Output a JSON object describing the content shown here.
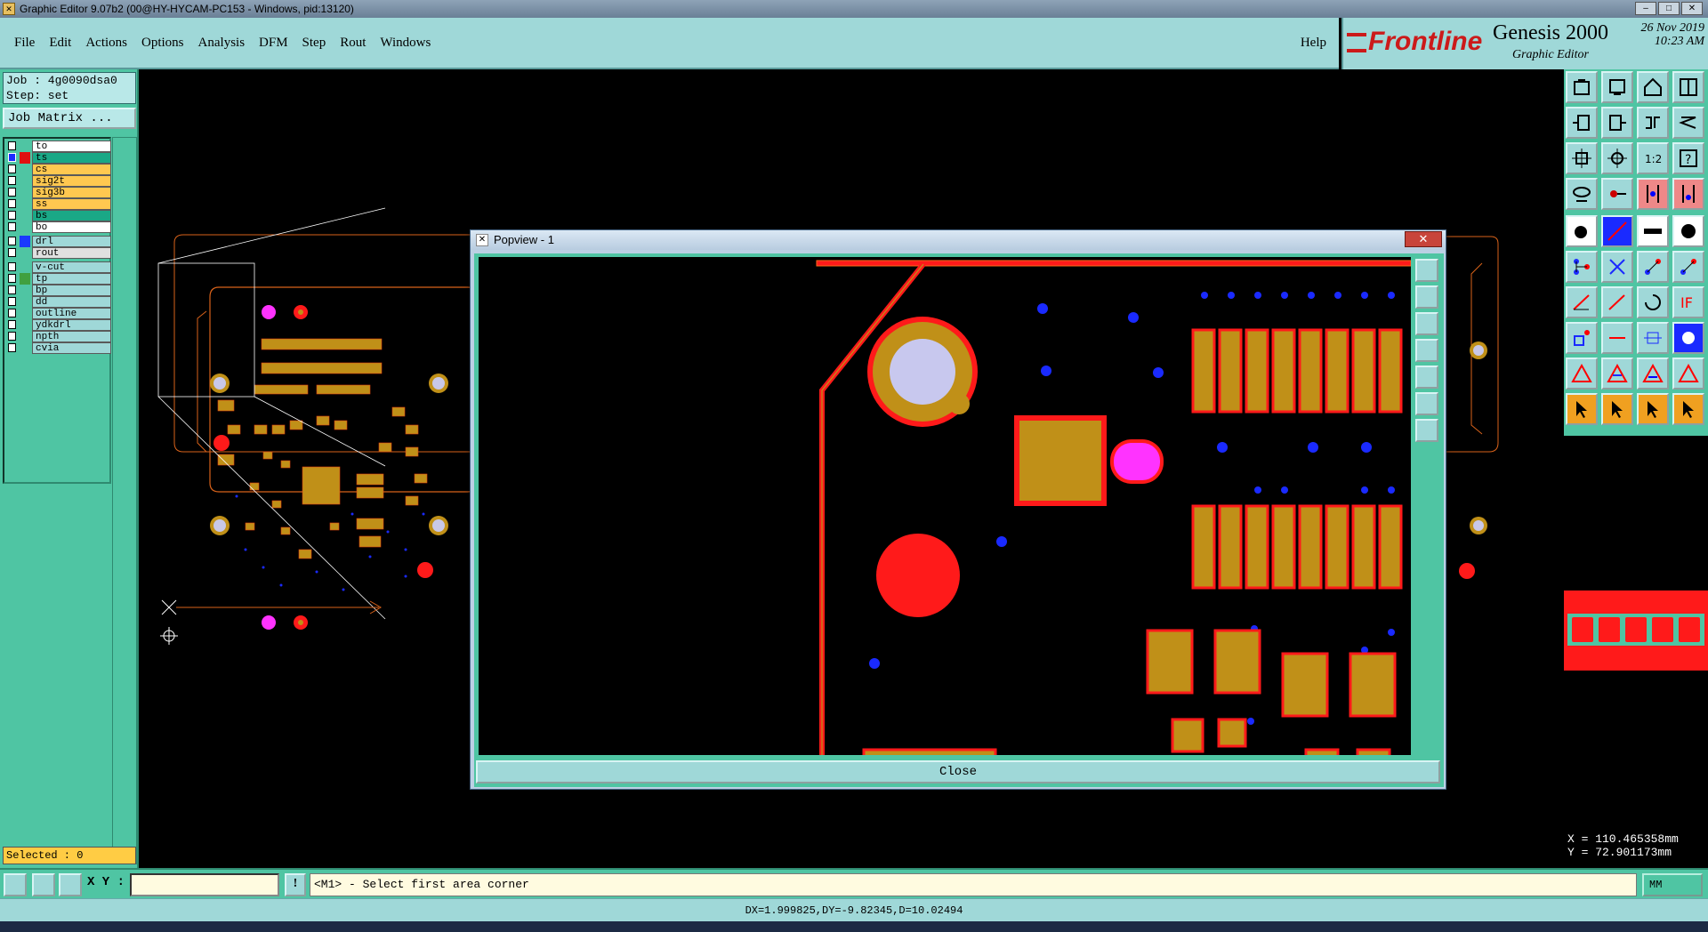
{
  "window": {
    "title": "Graphic Editor 9.07b2 (00@HY-HYCAM-PC153 - Windows, pid:13120)"
  },
  "menu": {
    "items": [
      "File",
      "Edit",
      "Actions",
      "Options",
      "Analysis",
      "DFM",
      "Step",
      "Rout",
      "Windows"
    ],
    "help": "Help"
  },
  "brand": {
    "logo": "Frontline",
    "product": "Genesis 2000",
    "subtitle": "Graphic Editor",
    "date": "26 Nov 2019",
    "time": "10:23 AM"
  },
  "job": {
    "job_label": "Job : 4g0090dsa0",
    "step_label": "Step: set",
    "matrix_button": "Job Matrix ..."
  },
  "layers": [
    {
      "name": "to",
      "color": "#ffffff",
      "swatch": ""
    },
    {
      "name": "ts",
      "color": "#1aa886",
      "swatch": "#e01010",
      "active": true
    },
    {
      "name": "cs",
      "color": "#ffc850",
      "swatch": ""
    },
    {
      "name": "sig2t",
      "color": "#ffc850",
      "swatch": ""
    },
    {
      "name": "sig3b",
      "color": "#ffc850",
      "swatch": ""
    },
    {
      "name": "ss",
      "color": "#ffc850",
      "swatch": ""
    },
    {
      "name": "bs",
      "color": "#1aa886",
      "swatch": ""
    },
    {
      "name": "bo",
      "color": "#ffffff",
      "swatch": ""
    },
    {
      "name": "drl",
      "color": "#9fd8d8",
      "swatch": "#1a3aff"
    },
    {
      "name": "rout",
      "color": "#e0e0e0",
      "swatch": ""
    },
    {
      "name": "v-cut",
      "color": "#9fd8d8",
      "swatch": ""
    },
    {
      "name": "tp",
      "color": "#9fd8d8",
      "swatch": "#40a040"
    },
    {
      "name": "bp",
      "color": "#9fd8d8",
      "swatch": ""
    },
    {
      "name": "dd",
      "color": "#9fd8d8",
      "swatch": ""
    },
    {
      "name": "outline",
      "color": "#9fd8d8",
      "swatch": ""
    },
    {
      "name": "ydkdrl",
      "color": "#9fd8d8",
      "swatch": ""
    },
    {
      "name": "npth",
      "color": "#9fd8d8",
      "swatch": ""
    },
    {
      "name": "cvia",
      "color": "#9fd8d8",
      "swatch": ""
    }
  ],
  "selected": "Selected : 0",
  "popup": {
    "title": "Popview - 1",
    "close_button": "Close"
  },
  "coords": {
    "x": "X = 110.465358mm",
    "y": "Y = 72.901173mm"
  },
  "cmd": {
    "xy_label": "X Y :",
    "xy_value": "",
    "info": "!",
    "prompt": "<M1> - Select first area corner",
    "units": "MM"
  },
  "status": "DX=1.999825,DY=-9.82345,D=10.02494",
  "colors": {
    "copper": "#c09018",
    "pad_outline": "#ff1a1a",
    "drill": "#1a2aff",
    "panel_bg": "#4fc5a3",
    "menu_bg": "#9fd8d8"
  }
}
